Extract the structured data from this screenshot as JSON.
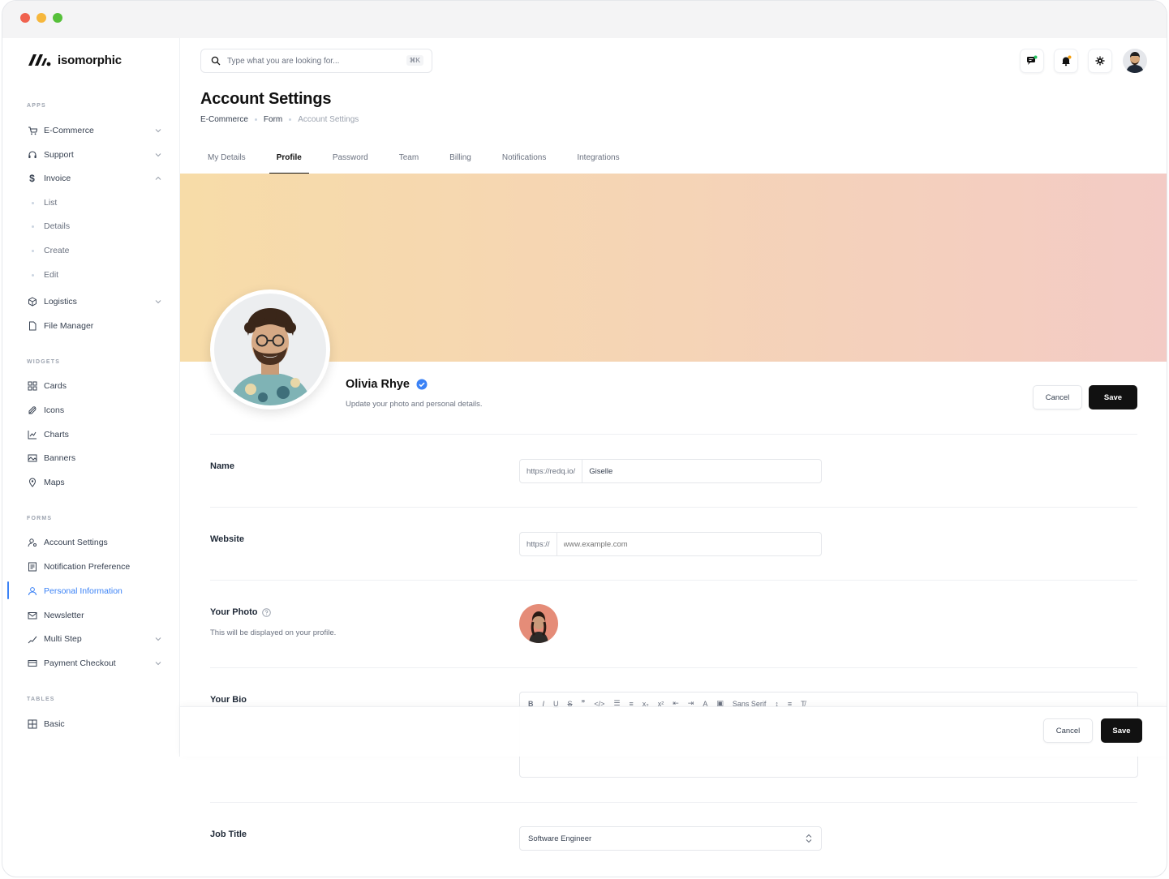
{
  "brand": {
    "name": "isomorphic"
  },
  "search": {
    "placeholder": "Type what you are looking for...",
    "shortcut": "⌘K"
  },
  "sidebar": {
    "sections": {
      "apps": "APPS",
      "widgets": "WIDGETS",
      "forms": "FORMS",
      "tables": "TABLES"
    },
    "apps": [
      {
        "label": "E-Commerce",
        "icon": "cart-icon"
      },
      {
        "label": "Support",
        "icon": "headset-icon"
      },
      {
        "label": "Invoice",
        "icon": "dollar-icon"
      }
    ],
    "invoice_sub": [
      "List",
      "Details",
      "Create",
      "Edit"
    ],
    "apps_more": [
      {
        "label": "Logistics",
        "icon": "package-icon"
      },
      {
        "label": "File Manager",
        "icon": "file-icon"
      }
    ],
    "widgets": [
      {
        "label": "Cards",
        "icon": "grid-icon"
      },
      {
        "label": "Icons",
        "icon": "feather-icon"
      },
      {
        "label": "Charts",
        "icon": "chart-icon"
      },
      {
        "label": "Banners",
        "icon": "image-icon"
      },
      {
        "label": "Maps",
        "icon": "map-pin-icon"
      }
    ],
    "forms": [
      {
        "label": "Account Settings",
        "icon": "user-gear-icon"
      },
      {
        "label": "Notification Preference",
        "icon": "bell-box-icon"
      },
      {
        "label": "Personal Information",
        "icon": "user-icon"
      },
      {
        "label": "Newsletter",
        "icon": "mail-icon"
      },
      {
        "label": "Multi Step",
        "icon": "steps-icon"
      },
      {
        "label": "Payment Checkout",
        "icon": "card-icon"
      }
    ],
    "tables": [
      {
        "label": "Basic",
        "icon": "table-icon"
      }
    ]
  },
  "header": {
    "notification_dot_color": "#22c55e",
    "bell_dot_color": "#f59e0b"
  },
  "page": {
    "title": "Account Settings",
    "breadcrumb": [
      "E-Commerce",
      "Form",
      "Account Settings"
    ]
  },
  "tabs": [
    "My Details",
    "Profile",
    "Password",
    "Team",
    "Billing",
    "Notifications",
    "Integrations"
  ],
  "active_tab": "Profile",
  "profile": {
    "name": "Olivia Rhye",
    "subtitle": "Update your photo and personal details.",
    "cancel": "Cancel",
    "save": "Save"
  },
  "form": {
    "name": {
      "label": "Name",
      "prefix": "https://redq.io/",
      "value": "Giselle"
    },
    "website": {
      "label": "Website",
      "prefix": "https://",
      "placeholder": "www.example.com"
    },
    "photo": {
      "label": "Your Photo",
      "help": "This will be displayed on your profile."
    },
    "bio": {
      "label": "Your Bio",
      "font": "Sans Serif"
    },
    "job_title": {
      "label": "Job Title",
      "value": "Software Engineer"
    }
  },
  "sticky": {
    "cancel": "Cancel",
    "save": "Save"
  }
}
